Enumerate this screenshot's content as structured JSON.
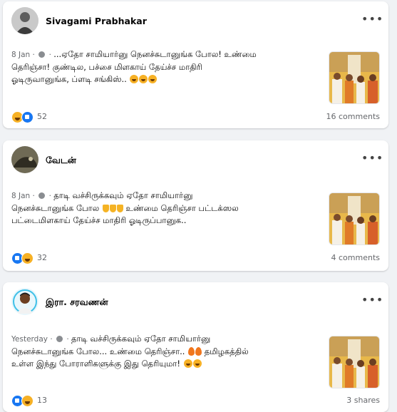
{
  "posts": [
    {
      "author": "Sivagami Prabhakar",
      "time": "8 Jan",
      "text_lines": [
        "...ஏதோ சாமியார்னு நெனச்சுடானுங்க போல! உண்மை",
        "தெரிஞ்சா! குண்டில, பச்சை மிளகாய் தேய்ச்ச மாதிரி",
        "ஓடிருவானுங்க, ப்ளடி சங்கிஸ்.."
      ],
      "reaction_count": "52",
      "footer_right": "16 comments"
    },
    {
      "author": "வேடன்",
      "time": "8 Jan",
      "text_lines": [
        "தாடி வச்சிருக்கவும் ஏதோ சாமியார்னு",
        "நெனச்சுடானுங்க போல",
        "உண்மை தெரிஞ்சா பட்டக்ஸல",
        "பட்டைமிளகாய் தேய்ச்ச மாதிரி ஓடிருப்பானுக.."
      ],
      "reaction_count": "32",
      "footer_right": "4 comments"
    },
    {
      "author": "இரா. சரவணன்",
      "time": "Yesterday",
      "text_lines": [
        "தாடி வச்சிருக்கவும் ஏதோ சாமியார்னு",
        "நெனச்சுடானுங்க போல... உண்மை தெரிஞ்சா..",
        "தமிழகத்தில்",
        "உள்ள இந்து போராளிகளுக்கு இது தெரியுமா!"
      ],
      "reaction_count": "13",
      "footer_right": "3 shares"
    }
  ],
  "colors": {
    "like": "#1877f2",
    "haha": "#f7b125",
    "muted": "#65676b",
    "bg": "#f0f2f5"
  },
  "icons": {
    "more": "more-horizontal-icon",
    "privacy": "globe-icon"
  }
}
